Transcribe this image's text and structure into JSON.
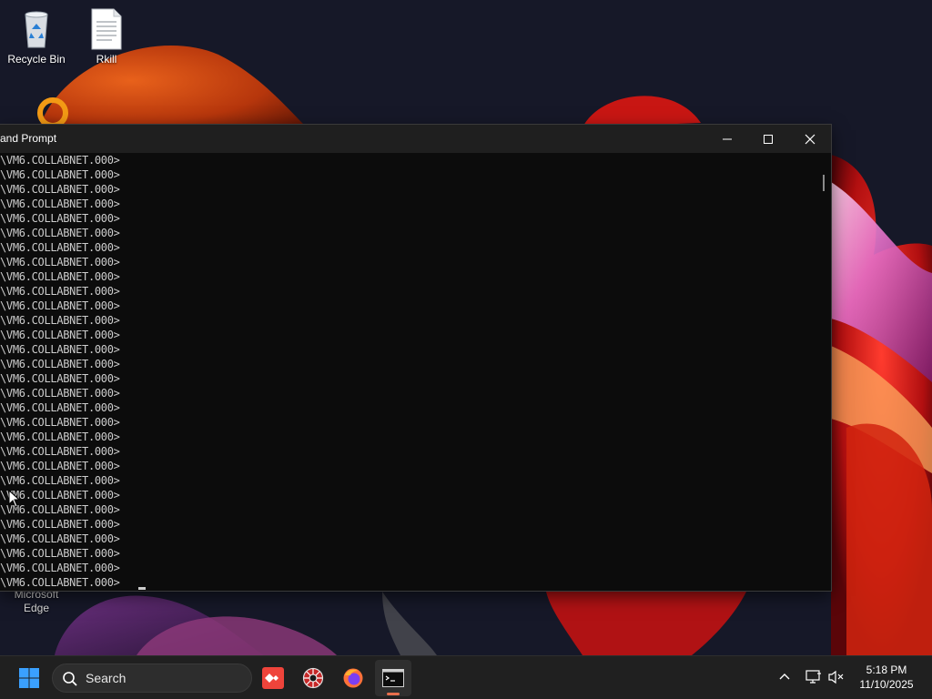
{
  "desktop": {
    "icons": [
      {
        "label": "Recycle Bin",
        "icon": "recycle-bin-icon"
      },
      {
        "label": "Rkill",
        "icon": "document-icon"
      },
      {
        "label_line1": "Microsoft",
        "label_line2": "Edge",
        "icon": "edge-icon"
      }
    ]
  },
  "cmd_window": {
    "title": "and Prompt",
    "buttons": {
      "minimize": "minimize-icon",
      "maximize": "maximize-icon",
      "close": "close-icon"
    },
    "prompt_line": "\\VM6.COLLABNET.000>",
    "line_count": 30
  },
  "taskbar": {
    "search_label": "Search",
    "apps": [
      "start-icon",
      "search-icon",
      "anydesk-icon",
      "settings-globe-icon",
      "firefox-icon",
      "terminal-icon"
    ],
    "active_app": "command-prompt",
    "accent_color": "#e96f4d"
  },
  "tray": {
    "icons": [
      "chevron-up-icon",
      "network-icon",
      "volume-muted-icon"
    ],
    "time": "5:18 PM",
    "date": "11/10/2025"
  }
}
